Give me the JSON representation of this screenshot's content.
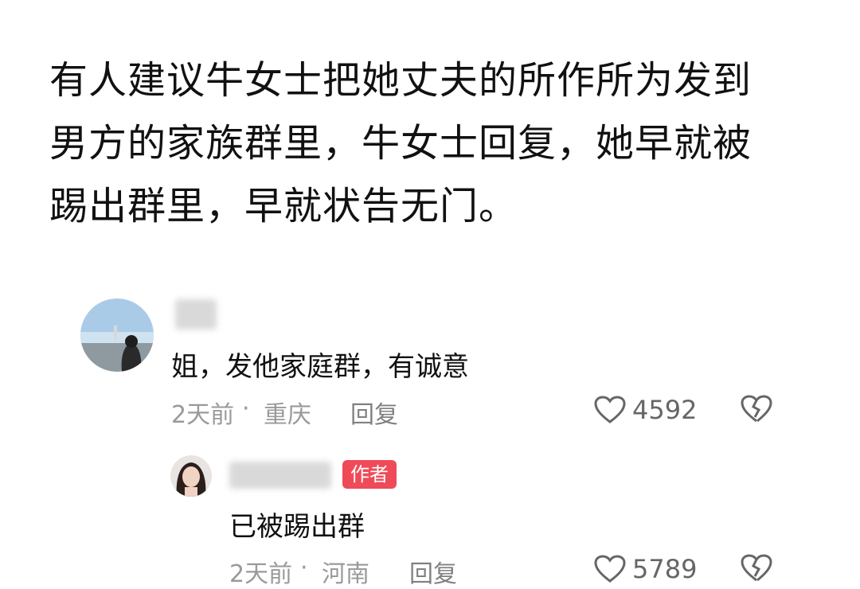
{
  "article": {
    "text": "有人建议牛女士把她丈夫的所作所为发到男方的家族群里，牛女士回复，她早就被踢出群里，早就状告无门。"
  },
  "comments": [
    {
      "username": "",
      "text": "姐，发他家庭群，有诚意",
      "time": "2天前",
      "location": "重庆",
      "reply_label": "回复",
      "likes": "4592",
      "avatar_icon": "beach-photo-avatar"
    },
    {
      "username": "",
      "author_badge": "作者",
      "text": "已被踢出群",
      "time": "2天前",
      "location": "河南",
      "reply_label": "回复",
      "likes": "5789",
      "avatar_icon": "woman-portrait-avatar"
    }
  ],
  "colors": {
    "badge": "#ef4a58",
    "meta_text": "#9a9a9a",
    "body_text": "#111111"
  }
}
